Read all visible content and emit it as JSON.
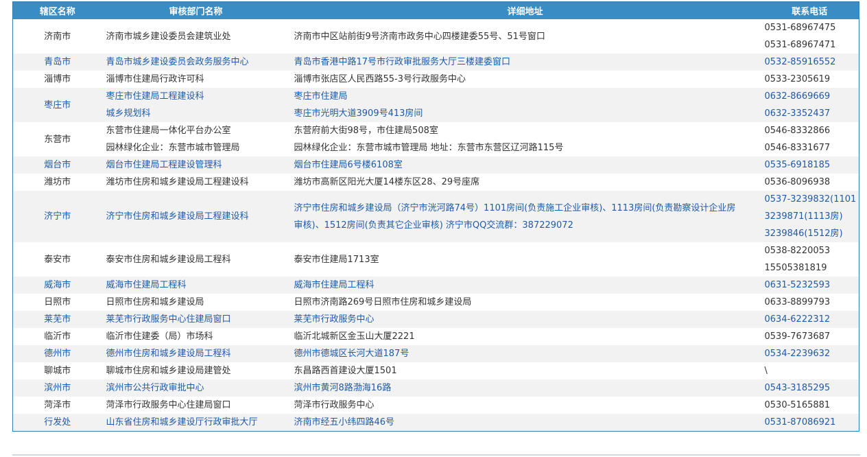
{
  "headers": {
    "region": "辖区名称",
    "dept": "审核部门名称",
    "addr": "详细地址",
    "phone": "联系电话"
  },
  "rows": [
    {
      "region": "济南市",
      "dept": [
        "济南市城乡建设委员会建筑业处"
      ],
      "addr": [
        "济南市中区站前街9号济南市政务中心四楼建委55号、51号窗口"
      ],
      "phone": [
        "0531-68967475",
        "0531-68967471"
      ],
      "style": "even"
    },
    {
      "region": "青岛市",
      "dept": [
        "青岛市城乡建设委员会政务服务中心"
      ],
      "addr": [
        "青岛市香港中路17号市行政审批服务大厅三楼建委窗口"
      ],
      "phone": [
        "0532-85916552"
      ],
      "style": "odd blue"
    },
    {
      "region": "淄博市",
      "dept": [
        "淄博市住建局行政许可科"
      ],
      "addr": [
        "淄博市张店区人民西路55-3号行政服务中心"
      ],
      "phone": [
        "0533-2305619"
      ],
      "style": "even"
    },
    {
      "region": "枣庄市",
      "dept": [
        "枣庄市住建局工程建设科",
        "城乡规划科"
      ],
      "addr": [
        "枣庄市住建局",
        "枣庄市光明大道3909号413房间"
      ],
      "phone": [
        "0632-8669669",
        "0632-3352437"
      ],
      "style": "odd blue"
    },
    {
      "region": "东营市",
      "dept": [
        "东营市住建局一体化平台办公室",
        "园林绿化企业：东营市城市管理局"
      ],
      "addr": [
        "东营府前大街98号，市住建局508室",
        "园林绿化企业：东营市城市管理局 地址：东营市东营区辽河路115号"
      ],
      "phone": [
        "0546-8332866",
        "0546-8331677"
      ],
      "style": "even"
    },
    {
      "region": "烟台市",
      "dept": [
        "烟台市住建局工程建设管理科"
      ],
      "addr": [
        "烟台市住建局6号楼6108室"
      ],
      "phone": [
        "0535-6918185"
      ],
      "style": "odd blue"
    },
    {
      "region": "潍坊市",
      "dept": [
        "潍坊市住房和城乡建设局工程建设科"
      ],
      "addr": [
        "潍坊市高新区阳光大厦14楼东区28、29号座席"
      ],
      "phone": [
        "0536-8096938"
      ],
      "style": "even"
    },
    {
      "region": "济宁市",
      "dept": [
        "济宁市住房和城乡建设局工程建设科"
      ],
      "addr": [
        "济宁市住房和城乡建设局（济宁市洸河路74号）1101房间(负责施工企业审核)、1113房间(负责勘察设计企业房",
        "审核)、1512房间(负责其它企业审核) 济宁市QQ交流群：387229072"
      ],
      "phone": [
        "0537-3239832(1101",
        "3239871(1113房)",
        "3239846(1512房)"
      ],
      "style": "odd blue"
    },
    {
      "region": "泰安市",
      "dept": [
        "泰安市住房和城乡建设局工程科"
      ],
      "addr": [
        "泰安市住建局1713室"
      ],
      "phone": [
        "0538-8220053",
        "15505381819"
      ],
      "style": "even"
    },
    {
      "region": "威海市",
      "dept": [
        "威海市住建局工程科"
      ],
      "addr": [
        "威海市住建局工程科"
      ],
      "phone": [
        "0631-5232593"
      ],
      "style": "odd blue"
    },
    {
      "region": "日照市",
      "dept": [
        "日照市住房和城乡建设局"
      ],
      "addr": [
        "日照市济南路269号日照市住房和城乡建设局"
      ],
      "phone": [
        "0633-8899793"
      ],
      "style": "even"
    },
    {
      "region": "莱芜市",
      "dept": [
        "莱芜市行政服务中心住建局窗口"
      ],
      "addr": [
        "莱芜市行政服务中心"
      ],
      "phone": [
        "0634-6222312"
      ],
      "style": "odd blue"
    },
    {
      "region": "临沂市",
      "dept": [
        "临沂市住建委（局）市场科"
      ],
      "addr": [
        "临沂北城新区金玉山大厦2221"
      ],
      "phone": [
        "0539-7673687"
      ],
      "style": "even"
    },
    {
      "region": "德州市",
      "dept": [
        "德州市住房和城乡建设局工程科"
      ],
      "addr": [
        "德州市德城区长河大道187号"
      ],
      "phone": [
        "0534-2239632"
      ],
      "style": "odd blue"
    },
    {
      "region": "聊城市",
      "dept": [
        "聊城市住房和城乡建设局建管处"
      ],
      "addr": [
        "东昌路西首建设大厦1501"
      ],
      "phone": [
        "\\"
      ],
      "style": "even"
    },
    {
      "region": "滨州市",
      "dept": [
        "滨州市公共行政审批中心"
      ],
      "addr": [
        "滨州市黄河8路渤海16路"
      ],
      "phone": [
        "0543-3185295"
      ],
      "style": "odd blue"
    },
    {
      "region": "菏泽市",
      "dept": [
        "菏泽市行政服务中心住建局窗口"
      ],
      "addr": [
        "菏泽市行政服务中心"
      ],
      "phone": [
        "0530-5165881"
      ],
      "style": "even"
    },
    {
      "region": "行发处",
      "dept": [
        "山东省住房和城乡建设厅行政审批大厅"
      ],
      "addr": [
        "济南市经五小纬四路46号"
      ],
      "phone": [
        "0531-87086921"
      ],
      "style": "odd blue"
    }
  ]
}
